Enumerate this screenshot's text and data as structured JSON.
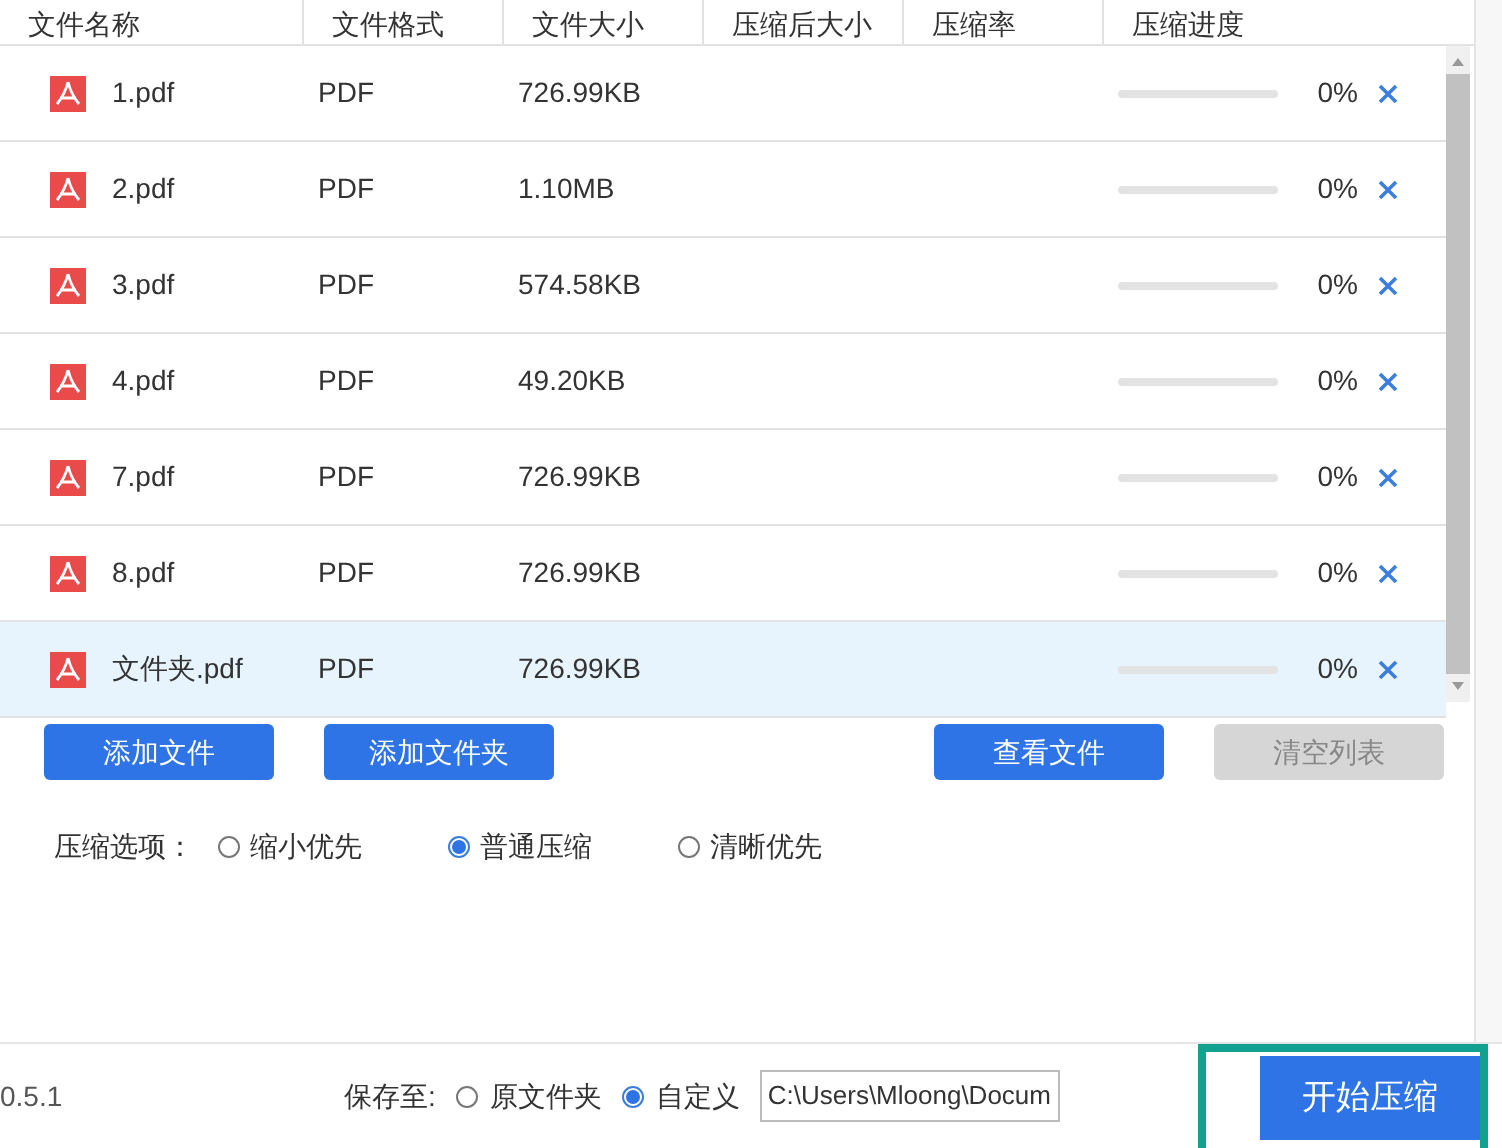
{
  "table": {
    "columns": [
      "文件名称",
      "文件格式",
      "文件大小",
      "压缩后大小",
      "压缩率",
      "压缩进度"
    ],
    "rows": [
      {
        "name": "1.pdf",
        "format": "PDF",
        "size": "726.99KB",
        "percent": "0%",
        "selected": false
      },
      {
        "name": "2.pdf",
        "format": "PDF",
        "size": "1.10MB",
        "percent": "0%",
        "selected": false
      },
      {
        "name": "3.pdf",
        "format": "PDF",
        "size": "574.58KB",
        "percent": "0%",
        "selected": false
      },
      {
        "name": "4.pdf",
        "format": "PDF",
        "size": "49.20KB",
        "percent": "0%",
        "selected": false
      },
      {
        "name": "7.pdf",
        "format": "PDF",
        "size": "726.99KB",
        "percent": "0%",
        "selected": false
      },
      {
        "name": "8.pdf",
        "format": "PDF",
        "size": "726.99KB",
        "percent": "0%",
        "selected": false
      },
      {
        "name": "文件夹.pdf",
        "format": "PDF",
        "size": "726.99KB",
        "percent": "0%",
        "selected": true
      }
    ]
  },
  "buttons": [
    {
      "label": "添加文件",
      "disabled": false
    },
    {
      "label": "添加文件夹",
      "disabled": false
    },
    {
      "label": "查看文件",
      "disabled": false
    },
    {
      "label": "清空列表",
      "disabled": true
    }
  ],
  "compression": {
    "label": "压缩选项：",
    "options": [
      {
        "label": "缩小优先",
        "selected": false
      },
      {
        "label": "普通压缩",
        "selected": true
      },
      {
        "label": "清晰优先",
        "selected": false
      }
    ]
  },
  "footer": {
    "version": "0.5.1",
    "save_label": "保存至:",
    "options": [
      {
        "label": "原文件夹",
        "selected": false
      },
      {
        "label": "自定义",
        "selected": true
      }
    ],
    "path": "C:\\Users\\Mloong\\Docum",
    "start_button": "开始压缩"
  }
}
